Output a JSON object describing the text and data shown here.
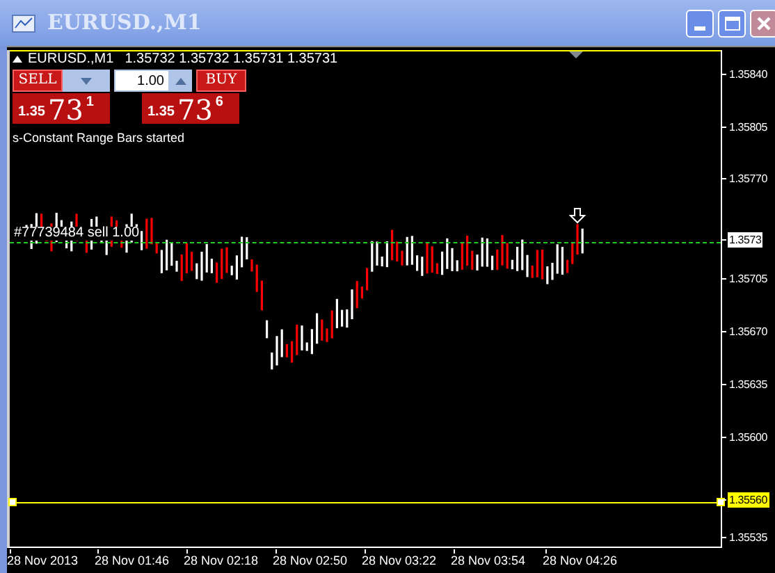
{
  "window": {
    "title": "EURUSD.,M1"
  },
  "chart": {
    "header": {
      "symbol": "EURUSD.,M1",
      "prices": "1.35732 1.35732 1.35731 1.35731"
    },
    "trade_panel": {
      "sell": {
        "label": "SELL",
        "big": "1.35",
        "pips": "73",
        "point": "1"
      },
      "lot": "1.00",
      "buy": {
        "label": "BUY",
        "big": "1.35",
        "pips": "73",
        "point": "6"
      }
    },
    "message": "s-Constant Range Bars started",
    "order_label": "#77739484 sell 1.00",
    "price_axis": [
      {
        "label": "1.35840",
        "kind": "plain"
      },
      {
        "label": "1.35805",
        "kind": "plain"
      },
      {
        "label": "1.35770",
        "kind": "plain"
      },
      {
        "label": "1.3573",
        "kind": "bid"
      },
      {
        "label": "1.35705",
        "kind": "plain"
      },
      {
        "label": "1.35670",
        "kind": "plain"
      },
      {
        "label": "1.35635",
        "kind": "plain"
      },
      {
        "label": "1.35600",
        "kind": "plain"
      },
      {
        "label": "1.35560",
        "kind": "line"
      },
      {
        "label": "1.35535",
        "kind": "plain"
      }
    ],
    "time_axis": [
      "28 Nov 2013",
      "28 Nov 01:46",
      "28 Nov 02:18",
      "28 Nov 02:50",
      "28 Nov 03:22",
      "28 Nov 03:54",
      "28 Nov 04:26"
    ]
  }
}
